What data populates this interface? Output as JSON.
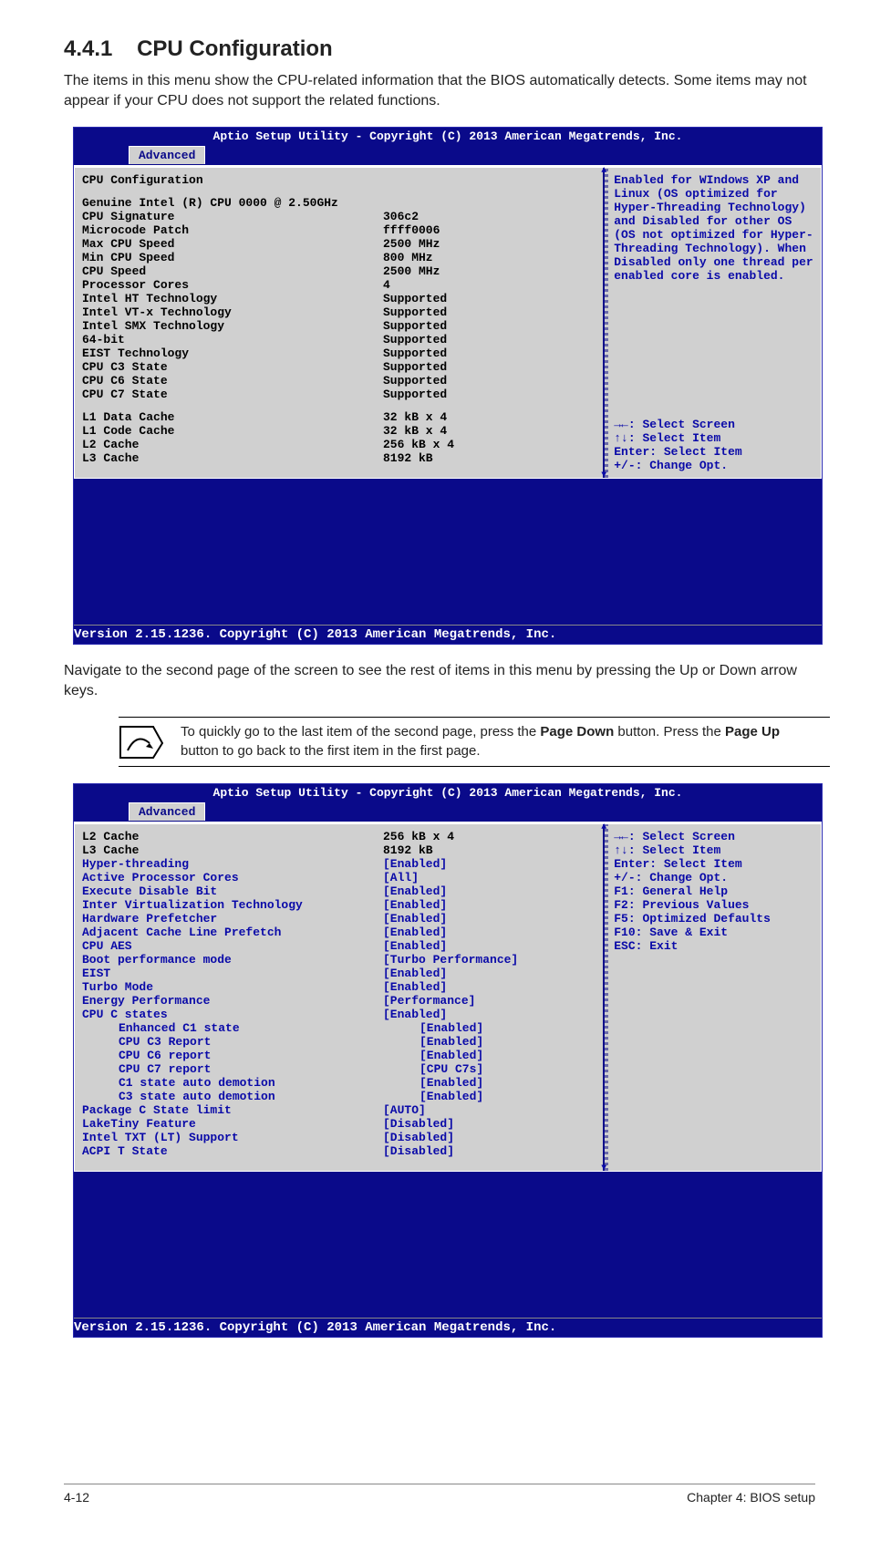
{
  "section_number": "4.4.1",
  "section_title": "CPU Configuration",
  "intro": "The items in this menu show the CPU-related information that the BIOS automatically detects. Some items may not appear if your CPU does not support the related functions.",
  "bios_title": "Aptio Setup Utility - Copyright (C) 2013 American Megatrends, Inc.",
  "bios_tab": "Advanced",
  "bios_footer": "Version 2.15.1236. Copyright (C) 2013 American Megatrends, Inc.",
  "bios1": {
    "heading": "CPU Configuration",
    "cpu_line": "Genuine Intel (R) CPU 0000 @ 2.50GHz",
    "rows": [
      {
        "k": "CPU Signature",
        "v": "306c2"
      },
      {
        "k": "Microcode Patch",
        "v": "ffff0006"
      },
      {
        "k": "Max CPU Speed",
        "v": "2500 MHz"
      },
      {
        "k": "Min CPU Speed",
        "v": "800 MHz"
      },
      {
        "k": "CPU Speed",
        "v": "2500 MHz"
      },
      {
        "k": "Processor Cores",
        "v": "4"
      },
      {
        "k": "Intel HT Technology",
        "v": "Supported"
      },
      {
        "k": "Intel VT-x Technology",
        "v": "Supported"
      },
      {
        "k": "Intel SMX Technology",
        "v": "Supported"
      },
      {
        "k": "64-bit",
        "v": "Supported"
      },
      {
        "k": "EIST Technology",
        "v": "Supported"
      },
      {
        "k": "CPU C3 State",
        "v": "Supported"
      },
      {
        "k": "CPU C6 State",
        "v": "Supported"
      },
      {
        "k": "CPU C7 State",
        "v": "Supported"
      }
    ],
    "cache": [
      {
        "k": "L1 Data Cache",
        "v": "32 kB x 4"
      },
      {
        "k": "L1 Code Cache",
        "v": "32 kB x 4"
      },
      {
        "k": "L2 Cache",
        "v": "256 kB x 4"
      },
      {
        "k": "L3 Cache",
        "v": "8192 kB"
      }
    ],
    "help": "Enabled for WIndows XP and Linux (OS optimized for Hyper-Threading Technology) and Disabled for other OS (OS not optimized for Hyper-Threading Technology). When Disabled only one thread per enabled core is enabled.",
    "nav": [
      "→←: Select Screen",
      "↑↓:  Select Item",
      "Enter: Select Item",
      "+/-: Change Opt."
    ]
  },
  "mid_text": "Navigate to the second page of the screen to see the rest of items in this menu by pressing the Up or Down arrow keys.",
  "tip_a": "To quickly go to the last item of the second page, press the ",
  "tip_b": "Page Down",
  "tip_c": " button. Press the ",
  "tip_d": "Page Up",
  "tip_e": " button to go back to the first item in the first page.",
  "bios2": {
    "top": [
      {
        "k": "L2 Cache",
        "v": "256 kB x 4"
      },
      {
        "k": "L3 Cache",
        "v": "8192 kB"
      }
    ],
    "items": [
      {
        "k": "Hyper-threading",
        "v": "[Enabled]",
        "indent": 0
      },
      {
        "k": "Active Processor Cores",
        "v": "[All]",
        "indent": 0
      },
      {
        "k": "Execute Disable Bit",
        "v": "[Enabled]",
        "indent": 0
      },
      {
        "k": "Inter Virtualization Technology",
        "v": "[Enabled]",
        "indent": 0
      },
      {
        "k": "Hardware Prefetcher",
        "v": "[Enabled]",
        "indent": 0
      },
      {
        "k": "Adjacent Cache Line Prefetch",
        "v": "[Enabled]",
        "indent": 0
      },
      {
        "k": "CPU AES",
        "v": "[Enabled]",
        "indent": 0
      },
      {
        "k": "Boot performance mode",
        "v": "[Turbo Performance]",
        "indent": 0
      },
      {
        "k": "EIST",
        "v": "[Enabled]",
        "indent": 0
      },
      {
        "k": "Turbo Mode",
        "v": "[Enabled]",
        "indent": 0
      },
      {
        "k": "Energy Performance",
        "v": "[Performance]",
        "indent": 0
      },
      {
        "k": "CPU C states",
        "v": "[Enabled]",
        "indent": 0
      },
      {
        "k": "Enhanced C1 state",
        "v": "[Enabled]",
        "indent": 1
      },
      {
        "k": "CPU C3 Report",
        "v": "[Enabled]",
        "indent": 1
      },
      {
        "k": "CPU C6 report",
        "v": "[Enabled]",
        "indent": 1
      },
      {
        "k": "CPU C7 report",
        "v": "[CPU C7s]",
        "indent": 1
      },
      {
        "k": "C1 state auto demotion",
        "v": "[Enabled]",
        "indent": 1
      },
      {
        "k": "C3 state auto demotion",
        "v": "[Enabled]",
        "indent": 1
      },
      {
        "k": "Package C State limit",
        "v": "[AUTO]",
        "indent": 0
      },
      {
        "k": "LakeTiny Feature",
        "v": "[Disabled]",
        "indent": 0
      },
      {
        "k": "Intel TXT (LT) Support",
        "v": "[Disabled]",
        "indent": 0
      },
      {
        "k": "ACPI T State",
        "v": "[Disabled]",
        "indent": 0
      }
    ],
    "nav": [
      "→←: Select Screen",
      "↑↓:  Select Item",
      "Enter: Select Item",
      "+/-: Change Opt.",
      "F1: General Help",
      "F2: Previous Values",
      "F5: Optimized Defaults",
      "F10: Save & Exit",
      "ESC: Exit"
    ]
  },
  "page_left": "4-12",
  "page_right": "Chapter 4: BIOS setup"
}
